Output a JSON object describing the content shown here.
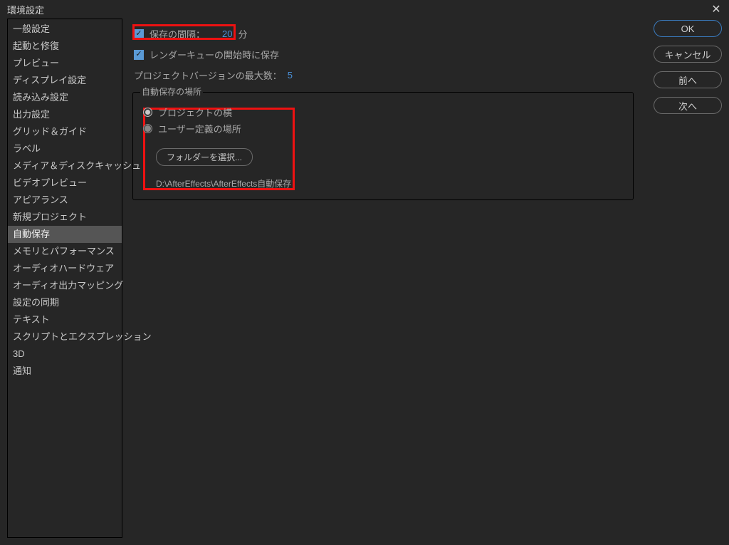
{
  "window": {
    "title": "環境設定"
  },
  "sidebar": {
    "items": [
      "一般設定",
      "起動と修復",
      "プレビュー",
      "ディスプレイ設定",
      "読み込み設定",
      "出力設定",
      "グリッド＆ガイド",
      "ラベル",
      "メディア＆ディスクキャッシュ",
      "ビデオプレビュー",
      "アピアランス",
      "新規プロジェクト",
      "自動保存",
      "メモリとパフォーマンス",
      "オーディオハードウェア",
      "オーディオ出力マッピング",
      "設定の同期",
      "テキスト",
      "スクリプトとエクスプレッション",
      "3D",
      "通知"
    ],
    "selected": "自動保存"
  },
  "settings": {
    "save_interval_label": "保存の間隔：",
    "save_interval_value": "20",
    "save_interval_unit": "分",
    "save_on_render_label": "レンダーキューの開始時に保存",
    "max_versions_label": "プロジェクトバージョンの最大数：",
    "max_versions_value": "5",
    "location_group_title": "自動保存の場所",
    "radio_next_to_project": "プロジェクトの横",
    "radio_user_defined": "ユーザー定義の場所",
    "choose_folder_button": "フォルダーを選択...",
    "folder_path": "D:\\AfterEffects\\AfterEffects自動保存"
  },
  "buttons": {
    "ok": "OK",
    "cancel": "キャンセル",
    "prev": "前へ",
    "next": "次へ"
  }
}
